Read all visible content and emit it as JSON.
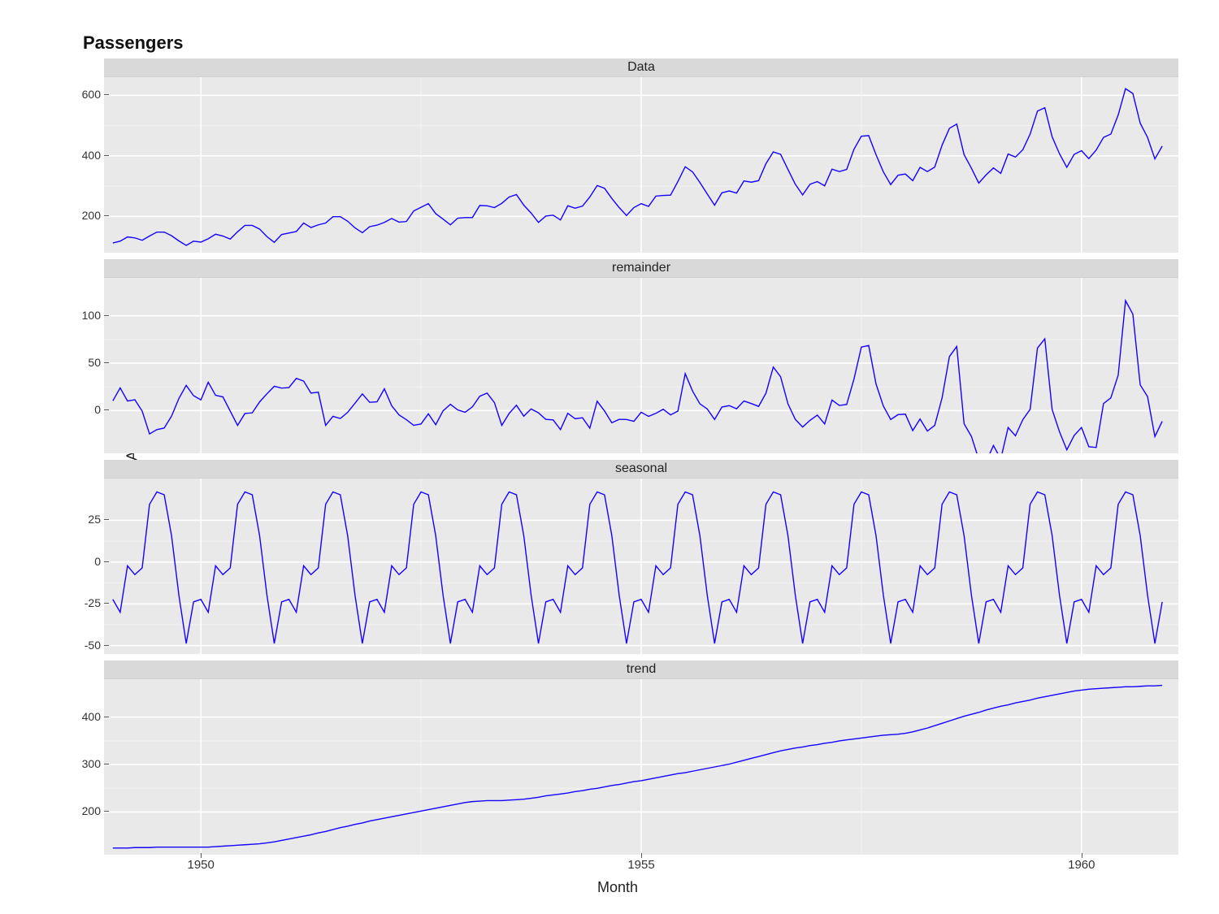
{
  "title": "Passengers",
  "xlabel": "Month",
  "ylabel": "Monthly Number of Airline Passengers",
  "line_color": "#1500ff",
  "panel_bg": "#e9e9e9",
  "strip_bg": "#d9d9d9",
  "grid_major": "#ffffff",
  "grid_minor": "#f3f3f3",
  "x_ticks": [
    1950,
    1955,
    1960
  ],
  "x_range": [
    1948.9,
    1961.1
  ],
  "facets": [
    {
      "label": "Data",
      "y_ticks": [
        200,
        400,
        600
      ],
      "y_range": [
        80,
        660
      ]
    },
    {
      "label": "remainder",
      "y_ticks": [
        0,
        50,
        100
      ],
      "y_range": [
        -45,
        140
      ]
    },
    {
      "label": "seasonal",
      "y_ticks": [
        -50,
        -25,
        0,
        25
      ],
      "y_range": [
        -55,
        50
      ]
    },
    {
      "label": "trend",
      "y_ticks": [
        200,
        300,
        400
      ],
      "y_range": [
        110,
        480
      ]
    }
  ],
  "chart_data": {
    "type": "line",
    "title": "Passengers",
    "xlabel": "Month",
    "ylabel": "Monthly Number of Airline Passengers",
    "x_start_year": 1949,
    "x_start_month": 1,
    "n": 144,
    "series": [
      {
        "name": "Data",
        "values": [
          112,
          118,
          132,
          129,
          121,
          135,
          148,
          148,
          136,
          119,
          104,
          118,
          115,
          126,
          141,
          135,
          125,
          149,
          170,
          170,
          158,
          133,
          114,
          140,
          145,
          150,
          178,
          163,
          172,
          178,
          199,
          199,
          184,
          162,
          146,
          166,
          171,
          180,
          193,
          181,
          183,
          218,
          230,
          242,
          209,
          191,
          172,
          194,
          196,
          196,
          236,
          235,
          229,
          243,
          264,
          272,
          237,
          211,
          180,
          201,
          204,
          188,
          235,
          227,
          234,
          264,
          302,
          293,
          259,
          229,
          203,
          229,
          242,
          233,
          267,
          269,
          270,
          315,
          364,
          347,
          312,
          274,
          237,
          278,
          284,
          277,
          317,
          313,
          318,
          374,
          413,
          405,
          355,
          306,
          271,
          306,
          315,
          301,
          356,
          348,
          355,
          422,
          465,
          467,
          404,
          347,
          305,
          336,
          340,
          318,
          362,
          348,
          363,
          435,
          491,
          505,
          404,
          359,
          310,
          337,
          360,
          342,
          406,
          396,
          420,
          472,
          548,
          559,
          463,
          407,
          362,
          405,
          417,
          391,
          419,
          461,
          472,
          535,
          622,
          606,
          508,
          461,
          390,
          432
        ]
      },
      {
        "name": "seasonal",
        "values": [
          -22.3,
          -30.0,
          -2.2,
          -7.5,
          -3.5,
          34.6,
          42.0,
          40.3,
          15.8,
          -19.8,
          -48.7,
          -23.8,
          -22.3,
          -30.0,
          -2.2,
          -7.5,
          -3.5,
          34.6,
          42.0,
          40.3,
          15.8,
          -19.8,
          -48.7,
          -23.8,
          -22.3,
          -30.0,
          -2.2,
          -7.5,
          -3.5,
          34.6,
          42.0,
          40.3,
          15.8,
          -19.8,
          -48.7,
          -23.8,
          -22.3,
          -30.0,
          -2.2,
          -7.5,
          -3.5,
          34.6,
          42.0,
          40.3,
          15.8,
          -19.8,
          -48.7,
          -23.8,
          -22.3,
          -30.0,
          -2.2,
          -7.5,
          -3.5,
          34.6,
          42.0,
          40.3,
          15.8,
          -19.8,
          -48.7,
          -23.8,
          -22.3,
          -30.0,
          -2.2,
          -7.5,
          -3.5,
          34.6,
          42.0,
          40.3,
          15.8,
          -19.8,
          -48.7,
          -23.8,
          -22.3,
          -30.0,
          -2.2,
          -7.5,
          -3.5,
          34.6,
          42.0,
          40.3,
          15.8,
          -19.8,
          -48.7,
          -23.8,
          -22.3,
          -30.0,
          -2.2,
          -7.5,
          -3.5,
          34.6,
          42.0,
          40.3,
          15.8,
          -19.8,
          -48.7,
          -23.8,
          -22.3,
          -30.0,
          -2.2,
          -7.5,
          -3.5,
          34.6,
          42.0,
          40.3,
          15.8,
          -19.8,
          -48.7,
          -23.8,
          -22.3,
          -30.0,
          -2.2,
          -7.5,
          -3.5,
          34.6,
          42.0,
          40.3,
          15.8,
          -19.8,
          -48.7,
          -23.8,
          -22.3,
          -30.0,
          -2.2,
          -7.5,
          -3.5,
          34.6,
          42.0,
          40.3,
          15.8,
          -19.8,
          -48.7,
          -23.8,
          -22.3,
          -30.0,
          -2.2,
          -7.5,
          -3.5,
          34.6,
          42.0,
          40.3,
          15.8,
          -19.8,
          -48.7,
          -23.8
        ]
      },
      {
        "name": "trend",
        "values": [
          124,
          124,
          124,
          125,
          125,
          125,
          126,
          126,
          126,
          126,
          126,
          126,
          126,
          126,
          127,
          128,
          129,
          130,
          131,
          132,
          133,
          135,
          137,
          140,
          143,
          146,
          149,
          152,
          156,
          159,
          163,
          167,
          170,
          174,
          177,
          181,
          184,
          187,
          190,
          193,
          196,
          199,
          202,
          205,
          208,
          211,
          214,
          217,
          220,
          222,
          223,
          224,
          224,
          224,
          225,
          226,
          227,
          229,
          231,
          234,
          236,
          238,
          240,
          243,
          245,
          248,
          250,
          253,
          256,
          258,
          261,
          264,
          266,
          269,
          272,
          275,
          278,
          281,
          283,
          286,
          289,
          292,
          295,
          298,
          301,
          305,
          309,
          313,
          317,
          321,
          325,
          329,
          332,
          335,
          337,
          340,
          342,
          345,
          347,
          350,
          352,
          354,
          356,
          358,
          360,
          362,
          363,
          364,
          366,
          369,
          373,
          377,
          382,
          387,
          392,
          397,
          402,
          406,
          410,
          415,
          419,
          423,
          426,
          430,
          433,
          436,
          440,
          443,
          446,
          449,
          452,
          455,
          457,
          459,
          460,
          461,
          462,
          463,
          464,
          464,
          465,
          466,
          466,
          467
        ]
      },
      {
        "name": "remainder",
        "values": [
          10.3,
          24.0,
          10.2,
          11.5,
          -0.5,
          -24.5,
          -20.0,
          -18.3,
          -5.8,
          12.8,
          26.7,
          15.8,
          11.3,
          30.0,
          16.2,
          14.5,
          -0.5,
          -15.5,
          -3.0,
          -2.3,
          9.2,
          17.8,
          25.7,
          23.8,
          24.3,
          34.0,
          31.2,
          18.5,
          19.5,
          -15.5,
          -6.0,
          -8.3,
          -1.8,
          7.8,
          17.7,
          8.8,
          9.3,
          23.0,
          5.2,
          -4.5,
          -9.5,
          -15.5,
          -14.0,
          -3.3,
          -14.8,
          -0.2,
          6.7,
          0.8,
          -1.7,
          4.0,
          15.2,
          18.5,
          8.5,
          -15.5,
          -3.0,
          5.7,
          -5.8,
          1.8,
          -2.3,
          -9.2,
          -9.7,
          -20.0,
          -2.8,
          -8.5,
          -7.5,
          -18.5,
          10.0,
          -0.3,
          -12.8,
          -9.2,
          -9.3,
          -11.2,
          -1.7,
          -6.0,
          -2.8,
          1.5,
          -4.5,
          -0.5,
          39.0,
          20.7,
          7.2,
          1.8,
          -9.3,
          3.8,
          5.3,
          2.0,
          10.2,
          7.5,
          4.5,
          18.4,
          46.0,
          35.7,
          7.2,
          -9.2,
          -17.3,
          -10.2,
          -4.7,
          -14.0,
          11.2,
          5.5,
          6.5,
          33.4,
          67.0,
          68.7,
          28.2,
          4.8,
          -9.3,
          -4.2,
          -3.7,
          -21.0,
          -8.8,
          -21.5,
          -15.5,
          13.4,
          57.0,
          67.7,
          -13.8,
          -27.2,
          -51.3,
          -54.2,
          -36.7,
          -51.0,
          -17.8,
          -26.5,
          -9.5,
          1.4,
          66.0,
          75.7,
          1.2,
          -22.2,
          -41.3,
          -26.2,
          -17.7,
          -38.0,
          -38.8,
          7.5,
          13.5,
          37.4,
          116.0,
          101.7,
          27.2,
          14.8,
          -27.3,
          -11.2
        ]
      }
    ]
  }
}
